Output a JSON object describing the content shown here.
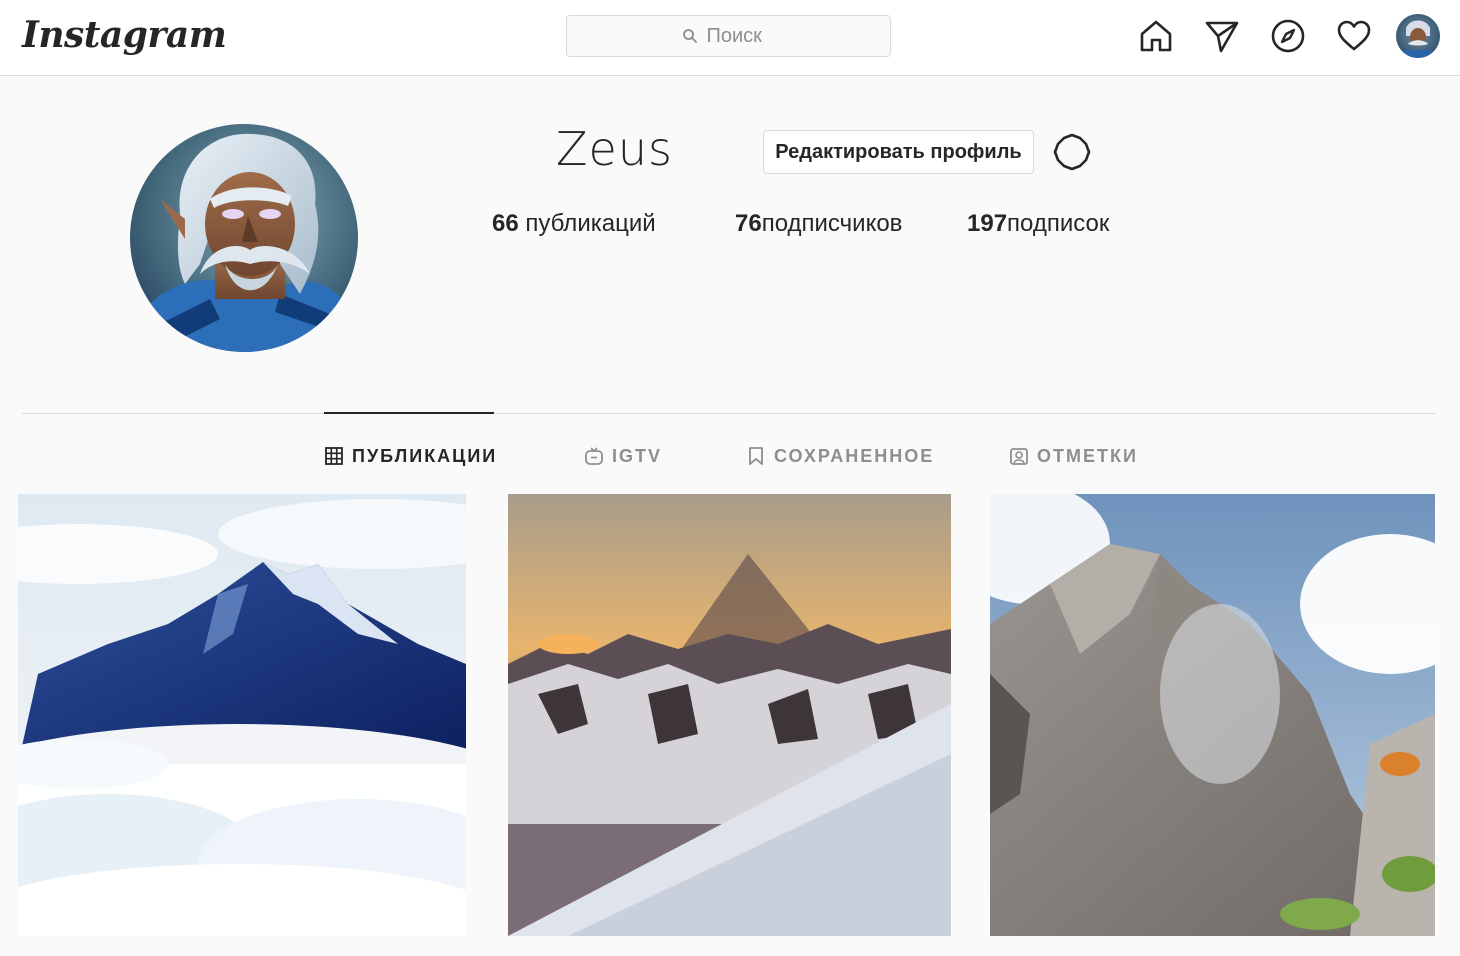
{
  "topbar": {
    "logo": "Instagram",
    "search_placeholder": "Поиск",
    "icons": [
      "home-icon",
      "direct-icon",
      "explore-icon",
      "activity-heart-icon",
      "profile-avatar-small"
    ]
  },
  "profile": {
    "username": "Zeus",
    "edit_button": "Редактировать профиль",
    "stats": {
      "posts_count": "66",
      "posts_label": "публикаций",
      "followers_count": "76",
      "followers_label": "подписчиков",
      "following_count": "197",
      "following_label": "подписок"
    }
  },
  "tabs": [
    {
      "label": "ПУБЛИКАЦИИ",
      "icon": "grid-icon",
      "active": true
    },
    {
      "label": "IGTV",
      "icon": "igtv-icon",
      "active": false
    },
    {
      "label": "СОХРАНЕННОЕ",
      "icon": "bookmark-icon",
      "active": false
    },
    {
      "label": "ОТМЕТКИ",
      "icon": "tagged-icon",
      "active": false
    }
  ],
  "colors": {
    "text": "#262626",
    "muted": "#8e8e8e",
    "border": "#dbdbdb",
    "background": "#fafafa"
  }
}
